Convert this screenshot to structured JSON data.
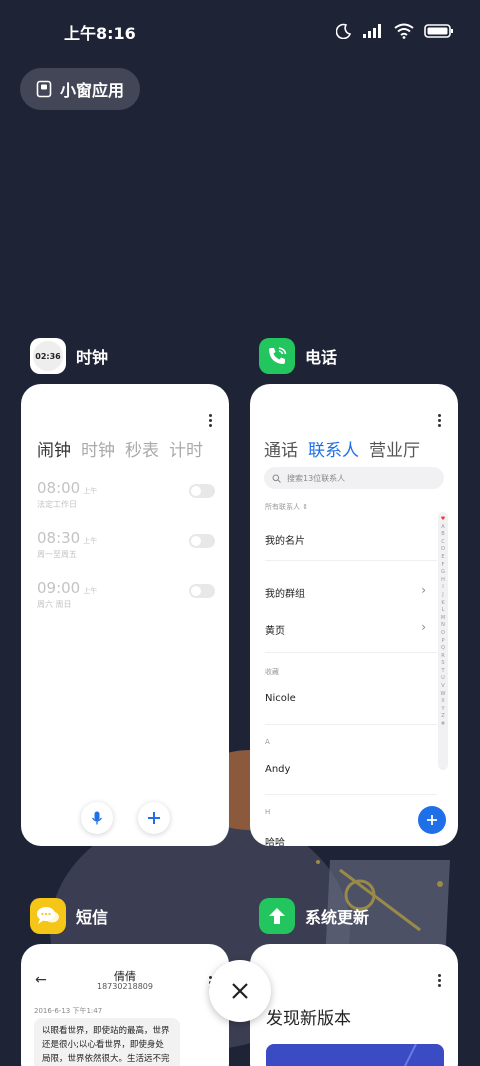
{
  "status": {
    "time": "上午8:16"
  },
  "floating_window": {
    "label": "小窗应用"
  },
  "apps": {
    "clock": {
      "name": "时钟",
      "icon_text": "02:36",
      "tabs": [
        "闹钟",
        "时钟",
        "秒表",
        "计时"
      ],
      "alarms": [
        {
          "time": "08:00",
          "ampm": "上午",
          "repeat": "法定工作日"
        },
        {
          "time": "08:30",
          "ampm": "上午",
          "repeat": "周一至周五"
        },
        {
          "time": "09:00",
          "ampm": "上午",
          "repeat": "周六 周日"
        }
      ]
    },
    "phone": {
      "name": "电话",
      "tabs": [
        "通话",
        "联系人",
        "营业厅"
      ],
      "search_placeholder": "搜索13位联系人",
      "filter_label": "所有联系人",
      "rows": {
        "my_card": "我的名片",
        "my_groups": "我的群组",
        "yellow_pages": "黄页",
        "favorites_label": "收藏",
        "fav_name": "Nicole",
        "a_label": "A",
        "a_name": "Andy",
        "h_label": "H",
        "h_name": "哈哈"
      },
      "alphabet": [
        "A",
        "B",
        "C",
        "D",
        "E",
        "F",
        "G",
        "H",
        "I",
        "J",
        "K",
        "L",
        "M",
        "N",
        "O",
        "P",
        "Q",
        "R",
        "S",
        "T",
        "U",
        "V",
        "W",
        "X",
        "Y",
        "Z",
        "#"
      ]
    },
    "sms": {
      "name": "短信",
      "contact": "倩倩",
      "number": "18730218809",
      "date": "2016-6-13 下午1:47",
      "message": "以眼看世界，即使站的最高，世界还是很小;以心看世界，即使身处局限，世界依然很大。生活远不完"
    },
    "update": {
      "name": "系统更新",
      "title": "发现新版本"
    }
  },
  "colors": {
    "background": "#1f2336",
    "accent_blue": "#1e6fe8",
    "phone_green": "#22c55e",
    "sms_yellow": "#f5c518"
  }
}
